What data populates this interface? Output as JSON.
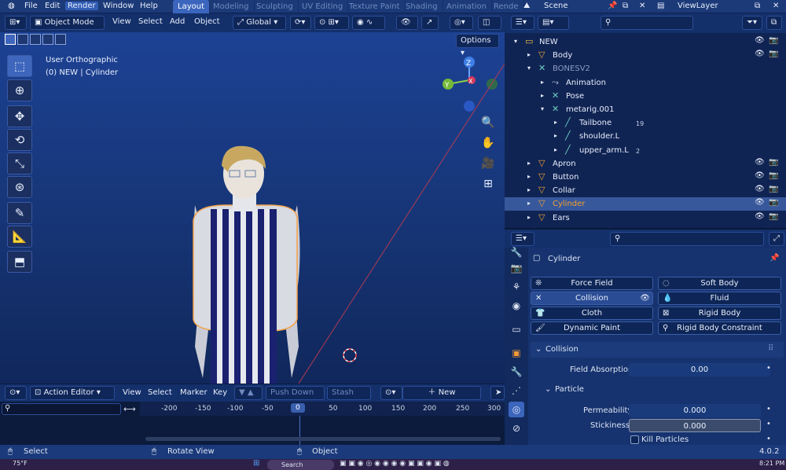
{
  "menu": {
    "file": "File",
    "edit": "Edit",
    "render": "Render",
    "window": "Window",
    "help": "Help"
  },
  "workspace_tabs": [
    "Layout",
    "Modeling",
    "Sculpting",
    "UV Editing",
    "Texture Paint",
    "Shading",
    "Animation",
    "Rende"
  ],
  "scene": {
    "name": "Scene",
    "view_layer": "ViewLayer"
  },
  "viewport": {
    "mode": "Object Mode",
    "menus": [
      "View",
      "Select",
      "Add",
      "Object"
    ],
    "transform": "Global",
    "options": "Options",
    "info_line1": "User Orthographic",
    "info_line2": "(0) NEW | Cylinder",
    "gizmo": {
      "z": "Z",
      "y": "Y",
      "x": "X"
    }
  },
  "action_editor": {
    "mode": "Action Editor",
    "menus": [
      "View",
      "Select",
      "Marker",
      "Key"
    ],
    "push_down": "Push Down",
    "stash": "Stash",
    "new": "New"
  },
  "timeline": {
    "ticks": [
      "-200",
      "-150",
      "-100",
      "-50",
      "0",
      "50",
      "100",
      "150",
      "200",
      "250",
      "300"
    ],
    "current": "0"
  },
  "status": {
    "select": "Select",
    "rotate": "Rotate View",
    "object": "Object",
    "version": "4.0.2"
  },
  "taskbar": {
    "weather": "75°F",
    "search": "Search",
    "time": "8:21 PM"
  },
  "outliner": {
    "rows": [
      {
        "label": "NEW",
        "indent": 0,
        "icon": "collection-icon",
        "sel": false
      },
      {
        "label": "Body",
        "indent": 1,
        "icon": "mesh-icon",
        "sel": false
      },
      {
        "label": "BONESV2",
        "indent": 1,
        "icon": "armature-icon",
        "sel": false,
        "dim": true
      },
      {
        "label": "Animation",
        "indent": 2,
        "icon": "action-icon",
        "sel": false
      },
      {
        "label": "Pose",
        "indent": 2,
        "icon": "pose-icon",
        "sel": false
      },
      {
        "label": "metarig.001",
        "indent": 2,
        "icon": "armature-icon",
        "sel": false
      },
      {
        "label": "Tailbone",
        "indent": 3,
        "icon": "bone-icon",
        "sel": false,
        "badge": "19"
      },
      {
        "label": "shoulder.L",
        "indent": 3,
        "icon": "bone-icon",
        "sel": false
      },
      {
        "label": "upper_arm.L",
        "indent": 3,
        "icon": "bone-icon",
        "sel": false,
        "badge": "2"
      },
      {
        "label": "Apron",
        "indent": 1,
        "icon": "mesh-icon",
        "sel": false
      },
      {
        "label": "Button",
        "indent": 1,
        "icon": "mesh-icon",
        "sel": false
      },
      {
        "label": "Collar",
        "indent": 1,
        "icon": "mesh-icon",
        "sel": false
      },
      {
        "label": "Cylinder",
        "indent": 1,
        "icon": "mesh-icon",
        "sel": true
      },
      {
        "label": "Ears",
        "indent": 1,
        "icon": "mesh-icon",
        "sel": false
      }
    ]
  },
  "properties": {
    "object_name": "Cylinder",
    "buttons": {
      "force_field": "Force Field",
      "soft_body": "Soft Body",
      "collision": "Collision",
      "fluid": "Fluid",
      "cloth": "Cloth",
      "rigid_body": "Rigid Body",
      "dynamic_paint": "Dynamic Paint",
      "rigid_body_constraint": "Rigid Body Constraint"
    },
    "collision_panel": "Collision",
    "field_absorption_label": "Field Absorption",
    "field_absorption": "0.00",
    "particle_panel": "Particle",
    "permeability_label": "Permeability",
    "permeability": "0.000",
    "stickiness_label": "Stickiness",
    "stickiness": "0.000",
    "kill_particles": "Kill Particles"
  },
  "colors": {
    "accent": "#3c66bd",
    "selected_text": "#f0a030",
    "viewport_top": "#1d4294",
    "panel": "#16336f"
  }
}
